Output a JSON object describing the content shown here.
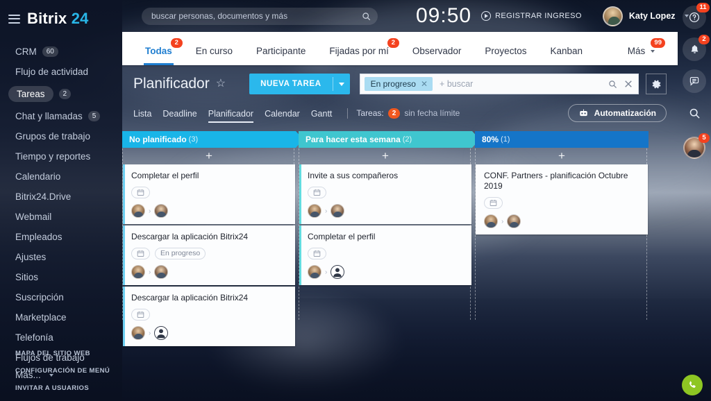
{
  "brand": {
    "name": "Bitrix",
    "number": "24"
  },
  "sidebar": {
    "items": [
      {
        "label": "CRM",
        "badge": "60",
        "active": false
      },
      {
        "label": "Flujo de actividad",
        "badge": "",
        "active": false
      },
      {
        "label": "Tareas",
        "badge": "2",
        "active": true
      },
      {
        "label": "Chat y llamadas",
        "badge": "5",
        "active": false
      },
      {
        "label": "Grupos de trabajo",
        "badge": "",
        "active": false
      },
      {
        "label": "Tiempo y reportes",
        "badge": "",
        "active": false
      },
      {
        "label": "Calendario",
        "badge": "",
        "active": false
      },
      {
        "label": "Bitrix24.Drive",
        "badge": "",
        "active": false
      },
      {
        "label": "Webmail",
        "badge": "",
        "active": false
      },
      {
        "label": "Empleados",
        "badge": "",
        "active": false
      },
      {
        "label": "Ajustes",
        "badge": "",
        "active": false
      },
      {
        "label": "Sitios",
        "badge": "",
        "active": false
      },
      {
        "label": "Suscripción",
        "badge": "",
        "active": false
      },
      {
        "label": "Marketplace",
        "badge": "",
        "active": false
      },
      {
        "label": "Telefonía",
        "badge": "",
        "active": false
      },
      {
        "label": "Flujos de trabajo",
        "badge": "",
        "active": false
      },
      {
        "label": "Más...",
        "badge": "",
        "active": false
      }
    ],
    "footer_links": [
      {
        "label": "MAPA DEL SITIO WEB"
      },
      {
        "label": "CONFIGURACIÓN DE MENÚ"
      },
      {
        "label": "INVITAR A USUARIOS"
      }
    ]
  },
  "topbar": {
    "search_placeholder": "buscar personas, documentos y más",
    "search_value": "",
    "clock": "09:50",
    "checkin_label": "REGISTRAR INGRESO",
    "user_name": "Katy Lopez"
  },
  "rail": {
    "help_badge": "11",
    "notifications_badge": "2",
    "avatar_badge": "5"
  },
  "tabs": [
    {
      "label": "Todas",
      "badge": "2",
      "active": true
    },
    {
      "label": "En curso",
      "badge": "",
      "active": false
    },
    {
      "label": "Participante",
      "badge": "",
      "active": false
    },
    {
      "label": "Fijadas por mí",
      "badge": "2",
      "active": false
    },
    {
      "label": "Observador",
      "badge": "",
      "active": false
    },
    {
      "label": "Proyectos",
      "badge": "",
      "active": false
    },
    {
      "label": "Kanban",
      "badge": "",
      "active": false
    },
    {
      "label": "Más",
      "badge": "99",
      "active": false
    }
  ],
  "header": {
    "page_title": "Planificador",
    "new_task_label": "NUEVA TAREA",
    "filter_chip": "En progreso",
    "filter_placeholder": "+ buscar"
  },
  "subnav": {
    "views": [
      {
        "label": "Lista",
        "active": false
      },
      {
        "label": "Deadline",
        "active": false
      },
      {
        "label": "Planificador",
        "active": true
      },
      {
        "label": "Calendar",
        "active": false
      },
      {
        "label": "Gantt",
        "active": false
      }
    ],
    "info_prefix": "Tareas:",
    "info_count": "2",
    "info_suffix": "sin fecha límite",
    "automation_label": "Automatización"
  },
  "board": {
    "columns": [
      {
        "title": "No planificado",
        "count": "(3)",
        "color": "#19b5e8",
        "shape": "chevron",
        "add_label": "+",
        "cards": [
          {
            "title": "Completar el perfil",
            "status": "",
            "has_date_icon": true,
            "people": [
              {
                "type": "photo"
              },
              {
                "type": "photo"
              }
            ]
          },
          {
            "title": "Descargar la aplicación Bitrix24",
            "status": "En progreso",
            "has_date_icon": true,
            "people": [
              {
                "type": "photo"
              },
              {
                "type": "photo"
              }
            ]
          },
          {
            "title": "Descargar la aplicación Bitrix24",
            "status": "",
            "has_date_icon": true,
            "people": [
              {
                "type": "photo"
              },
              {
                "type": "blank"
              }
            ]
          }
        ]
      },
      {
        "title": "Para hacer esta semana",
        "count": "(2)",
        "color": "#3fc6cf",
        "shape": "chevron",
        "add_label": "+",
        "cards": [
          {
            "title": "Invite a sus compañeros",
            "status": "",
            "has_date_icon": true,
            "people": [
              {
                "type": "photo"
              },
              {
                "type": "photo"
              }
            ]
          },
          {
            "title": "Completar el perfil",
            "status": "",
            "has_date_icon": true,
            "people": [
              {
                "type": "photo"
              },
              {
                "type": "blank"
              }
            ]
          }
        ]
      },
      {
        "title": "80%",
        "count": "(1)",
        "color": "#1575c8",
        "shape": "rect",
        "add_label": "+",
        "cards": [
          {
            "title": "CONF. Partners - planificación Octubre 2019",
            "status": "",
            "has_date_icon": true,
            "people": [
              {
                "type": "photo"
              },
              {
                "type": "photo"
              }
            ]
          }
        ]
      }
    ]
  }
}
